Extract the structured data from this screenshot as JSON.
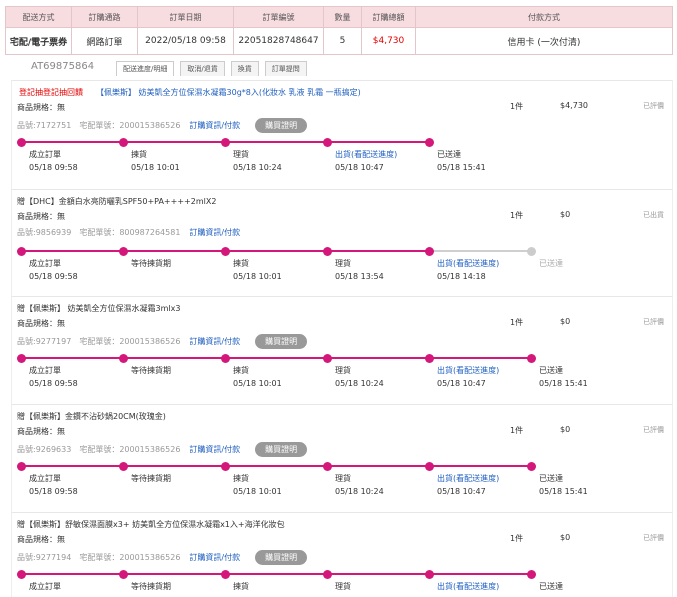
{
  "order": {
    "headers": [
      "配送方式",
      "訂購通路",
      "訂單日期",
      "訂單編號",
      "數量",
      "訂購總額",
      "付款方式"
    ],
    "row": [
      "宅配/電子票券",
      "網路訂單",
      "2022/05/18 09:58",
      "22051828748647",
      "5",
      "$4,730",
      "信用卡 (一次付清)"
    ]
  },
  "order_no": "AT69875864",
  "tabs": [
    "配送進度/明細",
    "取消/退貨",
    "換貨",
    "訂單提問"
  ],
  "items": [
    {
      "promo": "登記抽登記抽回饋",
      "promo_link": "【佩樂斯】 妨美凱全方位保濕水凝霜30g*8入(化妝水 乳液 乳霜 一瓶搞定)",
      "spec": "商品規格：無",
      "sku": "品號:7172751",
      "ship": "宅配單號：200015386526",
      "link": "訂購資訊/付款",
      "btn": "購買證明",
      "qty": "1件",
      "price": "$4,730",
      "status": "已評價",
      "steps": [
        {
          "label": "成立訂單",
          "time": "05/18 09:58"
        },
        {
          "label": "揀貨",
          "time": "05/18 10:01"
        },
        {
          "label": "理貨",
          "time": "05/18 10:24"
        },
        {
          "label": "出貨(看配送進度)",
          "time": "05/18 10:47"
        },
        {
          "label": "已送達",
          "time": "05/18 15:41"
        }
      ]
    },
    {
      "title": "贈【DHC】金額白水亮防曬乳SPF50+PA++++2mlX2",
      "spec": "商品規格：無",
      "sku": "品號:9856939",
      "ship": "宅配單號：800987264581",
      "link": "訂購資訊/付款",
      "qty": "1件",
      "price": "$0",
      "status": "已出貨",
      "steps": [
        {
          "label": "成立訂單",
          "time": "05/18 09:58"
        },
        {
          "label": "等待揀貨期",
          "time": ""
        },
        {
          "label": "揀貨",
          "time": "05/18 10:01"
        },
        {
          "label": "理貨",
          "time": "05/18 13:54"
        },
        {
          "label": "出貨(看配送進度)",
          "time": "05/18 14:18"
        },
        {
          "label": "已送達",
          "time": ""
        }
      ]
    },
    {
      "title": "贈【佩樂斯】 妨美凱全方位保濕水凝霜3mlx3",
      "spec": "商品規格：無",
      "sku": "品號:9277197",
      "ship": "宅配單號：200015386526",
      "link": "訂購資訊/付款",
      "btn": "購買證明",
      "qty": "1件",
      "price": "$0",
      "status": "已評價",
      "steps": [
        {
          "label": "成立訂單",
          "time": "05/18 09:58"
        },
        {
          "label": "等待揀貨期",
          "time": ""
        },
        {
          "label": "揀貨",
          "time": "05/18 10:01"
        },
        {
          "label": "理貨",
          "time": "05/18 10:24"
        },
        {
          "label": "出貨(看配送進度)",
          "time": "05/18 10:47"
        },
        {
          "label": "已送達",
          "time": "05/18 15:41"
        }
      ]
    },
    {
      "title": "贈【佩樂斯】金鑽不沾砂鍋20CM(玫瑰金)",
      "spec": "商品規格：無",
      "sku": "品號:9269633",
      "ship": "宅配單號：200015386526",
      "link": "訂購資訊/付款",
      "btn": "購買證明",
      "qty": "1件",
      "price": "$0",
      "status": "已評價",
      "steps": [
        {
          "label": "成立訂單",
          "time": "05/18 09:58"
        },
        {
          "label": "等待揀貨期",
          "time": ""
        },
        {
          "label": "揀貨",
          "time": "05/18 10:01"
        },
        {
          "label": "理貨",
          "time": "05/18 10:24"
        },
        {
          "label": "出貨(看配送進度)",
          "time": "05/18 10:47"
        },
        {
          "label": "已送達",
          "time": "05/18 15:41"
        }
      ]
    },
    {
      "title": "贈【佩樂斯】舒敏保濕面膜x3+ 妨美凱全方位保濕水凝霜x1入+海洋化妝包",
      "spec": "商品規格：無",
      "sku": "品號:9277194",
      "ship": "宅配單號：200015386526",
      "link": "訂購資訊/付款",
      "btn": "購買證明",
      "qty": "1件",
      "price": "$0",
      "status": "已評價",
      "steps": [
        {
          "label": "成立訂單",
          "time": ""
        },
        {
          "label": "等待揀貨期",
          "time": ""
        },
        {
          "label": "揀貨",
          "time": ""
        },
        {
          "label": "理貨",
          "time": ""
        },
        {
          "label": "出貨(看配送進度)",
          "time": ""
        },
        {
          "label": "已送達",
          "time": ""
        }
      ]
    }
  ],
  "colors": {
    "accent": "#d4177a",
    "link": "#1f5fc0",
    "price": "#e40000",
    "header_bg": "#f7dce0"
  }
}
